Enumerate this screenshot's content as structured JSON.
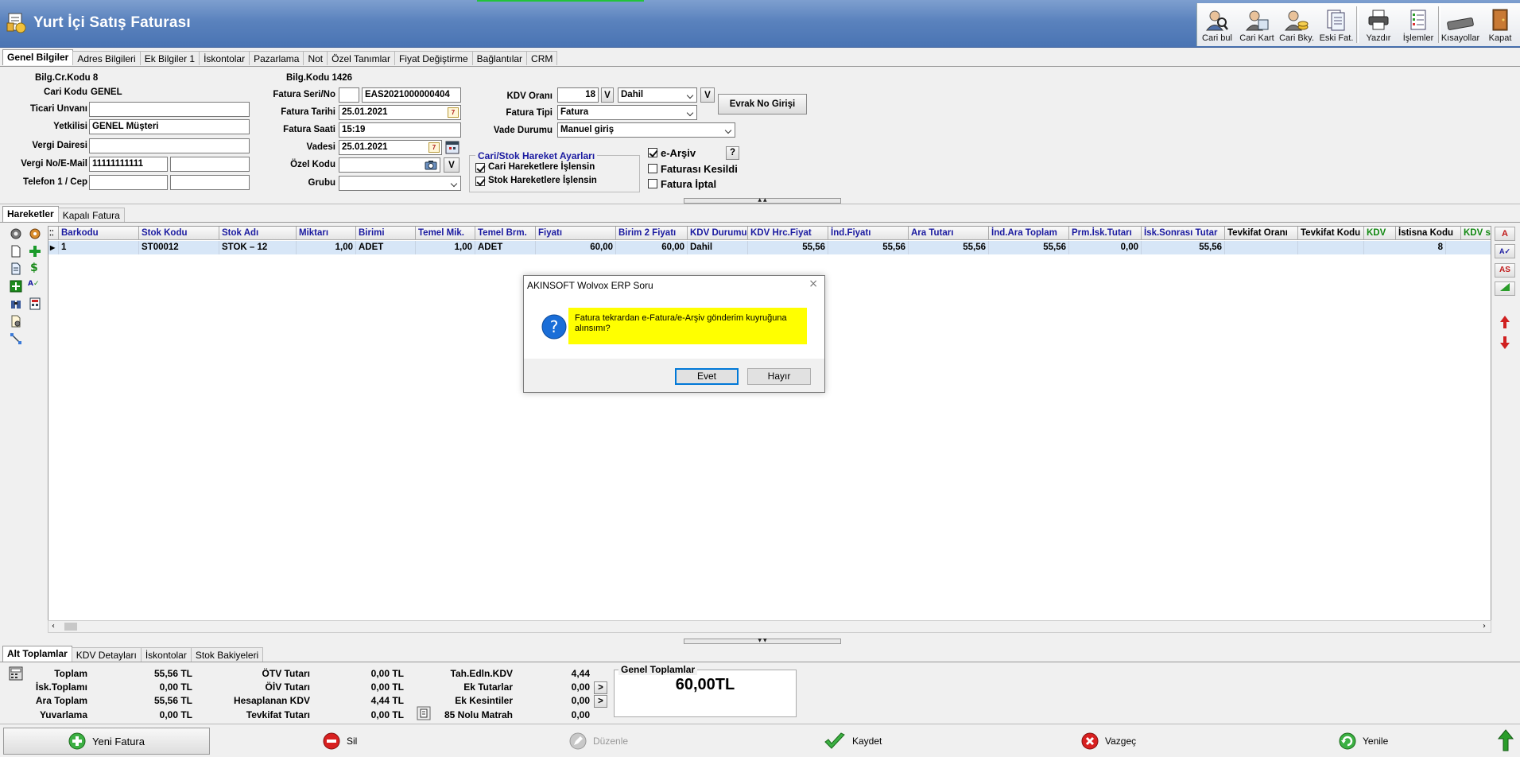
{
  "window": {
    "title": "Yurt İçi Satış Faturası"
  },
  "toolbar": {
    "items": [
      {
        "label": "Cari bul",
        "icon": "person-search-icon"
      },
      {
        "label": "Cari Kart",
        "icon": "person-card-icon"
      },
      {
        "label": "Cari Bky.",
        "icon": "person-coins-icon"
      },
      {
        "label": "Eski Fat.",
        "icon": "documents-icon"
      },
      {
        "label": "Yazdır",
        "icon": "printer-icon"
      },
      {
        "label": "İşlemler",
        "icon": "list-check-icon"
      },
      {
        "label": "Kısayollar",
        "icon": "keyboard-icon"
      },
      {
        "label": "Kapat",
        "icon": "door-exit-icon"
      }
    ]
  },
  "top_tabs": [
    "Genel Bilgiler",
    "Adres Bilgileri",
    "Ek Bilgiler 1",
    "İskontolar",
    "Pazarlama",
    "Not",
    "Özel Tanımlar",
    "Fiyat Değiştirme",
    "Bağlantılar",
    "CRM"
  ],
  "form": {
    "bilg_cr_kodu_label": "Bilg.Cr.Kodu",
    "bilg_cr_kodu": "8",
    "cari_kodu_label": "Cari Kodu",
    "cari_kodu": "GENEL",
    "ticari_unvani_label": "Ticari Unvanı",
    "ticari_unvani": "",
    "yetkilisi_label": "Yetkilisi",
    "yetkilisi": "GENEL Müşteri",
    "vergi_dairesi_label": "Vergi Dairesi",
    "vergi_dairesi": "",
    "vergi_no_label": "Vergi No/E-Mail",
    "vergi_no": "11111111111",
    "email": "",
    "telefon_label": "Telefon 1 / Cep",
    "telefon1": "",
    "cep": "",
    "bilg_kodu_label": "Bilg.Kodu",
    "bilg_kodu": "1426",
    "fatura_seri_label": "Fatura Seri/No",
    "fatura_seri": "",
    "fatura_no": "EAS2021000000404",
    "fatura_tarihi_label": "Fatura Tarihi",
    "fatura_tarihi": "25.01.2021",
    "fatura_saati_label": "Fatura Saati",
    "fatura_saati": "15:19",
    "vadesi_label": "Vadesi",
    "vadesi": "25.01.2021",
    "ozel_kodu_label": "Özel Kodu",
    "ozel_kodu": "",
    "grubu_label": "Grubu",
    "grubu": "",
    "kdv_orani_label": "KDV Oranı",
    "kdv_orani": "18",
    "kdv_dahil": "Dahil",
    "fatura_tipi_label": "Fatura Tipi",
    "fatura_tipi": "Fatura",
    "vade_durumu_label": "Vade Durumu",
    "vade_durumu": "Manuel giriş",
    "v_button": "V",
    "evrak_button": "Evrak No Girişi",
    "help_button": "?",
    "calendar_glyph": "7"
  },
  "hareket_group": {
    "title": "Cari/Stok Hareket Ayarları",
    "cari": "Cari Hareketlere İşlensin",
    "stok": "Stok Hareketlere İşlensin"
  },
  "checks": {
    "earsiv": "e-Arşiv",
    "kesildi": "Faturası Kesildi",
    "iptal": "Fatura İptal"
  },
  "mid_tabs": [
    "Hareketler",
    "Kapalı Fatura"
  ],
  "grid": {
    "columns": [
      "Barkodu",
      "Stok Kodu",
      "Stok Adı",
      "Miktarı",
      "Birimi",
      "Temel Mik.",
      "Temel Brm.",
      "Fiyatı",
      "Birim 2 Fiyatı",
      "KDV Durumu",
      "KDV Hrc.Fiyat",
      "İnd.Fiyatı",
      "Ara Tutarı",
      "İnd.Ara Toplam",
      "Prm.İsk.Tutarı",
      "İsk.Sonrası Tutar",
      "Tevkifat Oranı",
      "Tevkifat Kodu",
      "KDV",
      "İstisna Kodu",
      "KDV siz"
    ],
    "rows": [
      [
        "1",
        "ST00012",
        "STOK – 12",
        "1,00",
        "ADET",
        "1,00",
        "ADET",
        "60,00",
        "60,00",
        "Dahil",
        "55,56",
        "55,56",
        "55,56",
        "55,56",
        "0,00",
        "55,56",
        "",
        "",
        "8",
        "",
        ""
      ]
    ]
  },
  "right_buttons": [
    "A",
    "AS"
  ],
  "bottom_tabs": [
    "Alt Toplamlar",
    "KDV Detayları",
    "İskontolar",
    "Stok Bakiyeleri"
  ],
  "totals": {
    "toplam_label": "Toplam",
    "toplam": "55,56 TL",
    "isk_label": "İsk.Toplamı",
    "isk": "0,00 TL",
    "ara_label": "Ara Toplam",
    "ara": "55,56 TL",
    "yuv_label": "Yuvarlama",
    "yuv": "0,00 TL",
    "otv_label": "ÖTV Tutarı",
    "otv": "0,00 TL",
    "oiv_label": "ÖİV Tutarı",
    "oiv": "0,00 TL",
    "hkdv_label": "Hesaplanan KDV",
    "hkdv": "4,44 TL",
    "tevk_label": "Tevkifat Tutarı",
    "tevk": "0,00 TL",
    "tah_label": "Tah.Edln.KDV",
    "tah": "4,44",
    "ekt_label": "Ek Tutarlar",
    "ekt": "0,00",
    "ekk_label": "Ek Kesintiler",
    "ekk": "0,00",
    "m85_label": "85 Nolu Matrah",
    "m85": "0,00",
    "genel_label": "Genel Toplamlar",
    "genel": "60,00TL",
    "arrow": ">"
  },
  "bottom_buttons": {
    "yeni": "Yeni Fatura",
    "sil": "Sil",
    "duzenle": "Düzenle",
    "kaydet": "Kaydet",
    "vazgec": "Vazgeç",
    "yenile": "Yenile"
  },
  "dialog": {
    "title": "AKINSOFT Wolvox ERP Soru",
    "message": "Fatura tekrardan e-Fatura/e-Arşiv gönderim kuyruğuna alınsımı?",
    "yes": "Evet",
    "no": "Hayır"
  },
  "colors": {
    "header": "#5a82bd",
    "highlight": "#ffff00",
    "grid_selected": "#d7e6f7",
    "link_blue": "#1a1aa0"
  }
}
